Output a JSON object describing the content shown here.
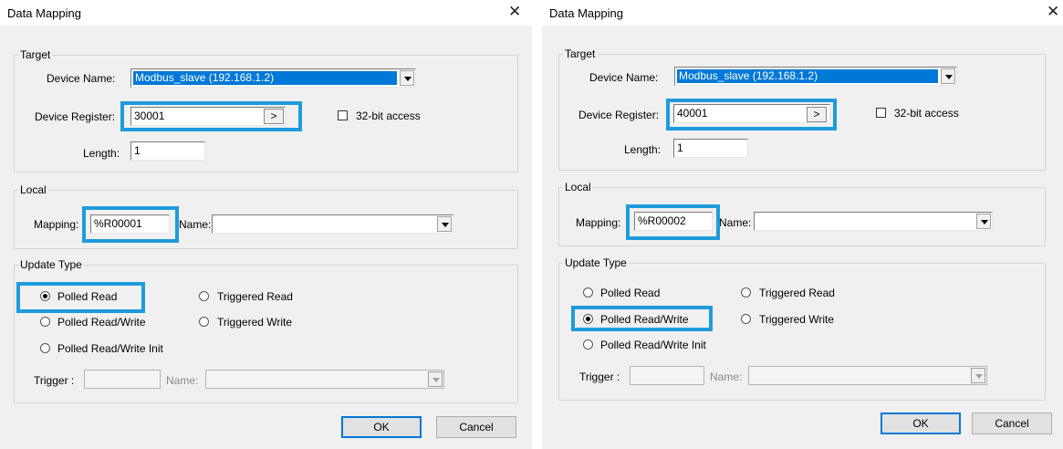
{
  "colors": {
    "highlight": "#1e9bdc",
    "selection": "#0078d7",
    "dialog_bg": "#f0f0f0"
  },
  "dialogs": [
    {
      "title": "Data Mapping",
      "close_icon": "close-icon",
      "target": {
        "legend": "Target",
        "device_name_label": "Device Name:",
        "device_name_value": "Modbus_slave (192.168.1.2)",
        "device_register_label": "Device Register:",
        "device_register_value": "30001",
        "browse_label": ">",
        "bit32_label": "32-bit access",
        "bit32_checked": false,
        "length_label": "Length:",
        "length_value": "1"
      },
      "local": {
        "legend": "Local",
        "mapping_label": "Mapping:",
        "mapping_value": "%R00001",
        "name_label": "Name:",
        "name_value": ""
      },
      "update_type": {
        "legend": "Update Type",
        "options": [
          "Polled Read",
          "Triggered Read",
          "Polled Read/Write",
          "Triggered Write",
          "Polled Read/Write Init"
        ],
        "selected": "Polled Read",
        "trigger_label": "Trigger :",
        "trigger_value": "",
        "trigger_name_label": "Name:"
      },
      "ok_label": "OK",
      "cancel_label": "Cancel"
    },
    {
      "title": "Data Mapping",
      "close_icon": "close-icon",
      "target": {
        "legend": "Target",
        "device_name_label": "Device Name:",
        "device_name_value": "Modbus_slave (192.168.1.2)",
        "device_register_label": "Device Register:",
        "device_register_value": "40001",
        "browse_label": ">",
        "bit32_label": "32-bit access",
        "bit32_checked": false,
        "length_label": "Length:",
        "length_value": "1"
      },
      "local": {
        "legend": "Local",
        "mapping_label": "Mapping:",
        "mapping_value": "%R00002",
        "name_label": "Name:",
        "name_value": ""
      },
      "update_type": {
        "legend": "Update Type",
        "options": [
          "Polled Read",
          "Triggered Read",
          "Polled Read/Write",
          "Triggered Write",
          "Polled Read/Write Init"
        ],
        "selected": "Polled Read/Write",
        "trigger_label": "Trigger :",
        "trigger_value": "",
        "trigger_name_label": "Name:"
      },
      "ok_label": "OK",
      "cancel_label": "Cancel"
    }
  ]
}
